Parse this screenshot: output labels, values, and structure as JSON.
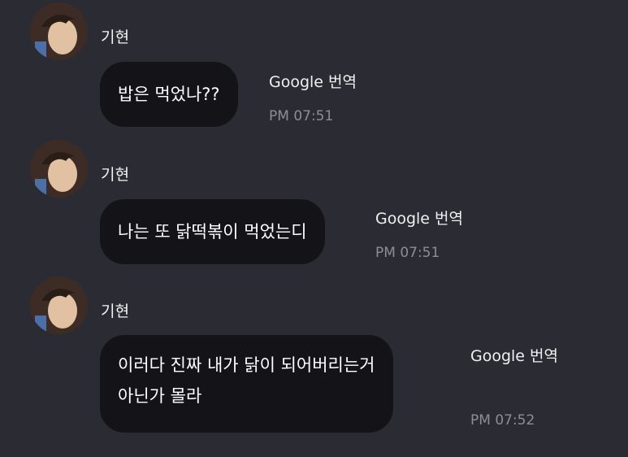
{
  "messages": [
    {
      "sender": "기현",
      "text_lines": [
        "밥은 먹었나??"
      ],
      "translate_label": "Google 번역",
      "time": "PM 07:51"
    },
    {
      "sender": "기현",
      "text_lines": [
        "나는 또 닭떡볶이 먹었는디"
      ],
      "translate_label": "Google 번역",
      "time": "PM 07:51"
    },
    {
      "sender": "기현",
      "text_lines": [
        "이러다 진짜 내가 닭이 되어버리는거",
        "아닌가 몰라"
      ],
      "translate_label": "Google 번역",
      "time": "PM 07:52"
    }
  ],
  "colors": {
    "background": "#2b2c33",
    "bubble": "#141418",
    "text": "#ffffff",
    "timestamp": "#8d8d96"
  },
  "icons": {
    "avatar": "profile-photo"
  }
}
